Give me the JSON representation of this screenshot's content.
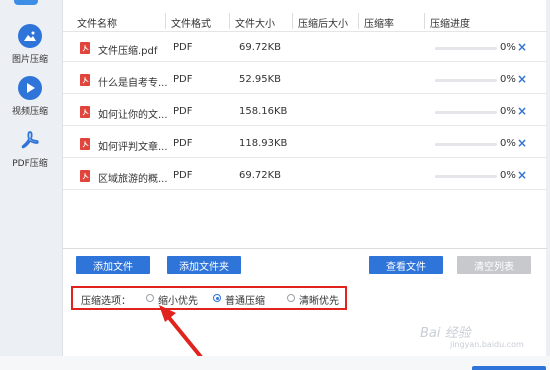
{
  "sidebar": {
    "items": [
      {
        "label": "图片压缩",
        "icon": "image-icon"
      },
      {
        "label": "视频压缩",
        "icon": "play-icon"
      },
      {
        "label": "PDF压缩",
        "icon": "pdf-icon",
        "active": true
      }
    ]
  },
  "table": {
    "columns": [
      "文件名称",
      "文件格式",
      "文件大小",
      "压缩后大小",
      "压缩率",
      "压缩进度"
    ],
    "rows": [
      {
        "name": "文件压缩.pdf",
        "format": "PDF",
        "size": "69.72KB",
        "compressed": "",
        "ratio": "",
        "progress": 0,
        "progress_label": "0%"
      },
      {
        "name": "什么是自考专...",
        "format": "PDF",
        "size": "52.95KB",
        "compressed": "",
        "ratio": "",
        "progress": 0,
        "progress_label": "0%"
      },
      {
        "name": "如何让你的文...",
        "format": "PDF",
        "size": "158.16KB",
        "compressed": "",
        "ratio": "",
        "progress": 0,
        "progress_label": "0%"
      },
      {
        "name": "如何评判文章...",
        "format": "PDF",
        "size": "118.93KB",
        "compressed": "",
        "ratio": "",
        "progress": 0,
        "progress_label": "0%"
      },
      {
        "name": "区域旅游的概...",
        "format": "PDF",
        "size": "69.72KB",
        "compressed": "",
        "ratio": "",
        "progress": 0,
        "progress_label": "0%"
      }
    ]
  },
  "actions": {
    "add_file": "添加文件",
    "add_folder": "添加文件夹",
    "view_file": "查看文件",
    "clear_list": "清空列表"
  },
  "options": {
    "title": "压缩选项：",
    "choices": [
      "缩小优先",
      "普通压缩",
      "清晰优先"
    ],
    "selected": "普通压缩"
  },
  "watermark": {
    "text": "Bai 经验",
    "url": "jingyan.baidu.com"
  },
  "colors": {
    "accent": "#2e74d9",
    "highlight_border": "#e0231c",
    "file_icon": "#e0443a",
    "disabled_button": "#c7c9cc"
  }
}
